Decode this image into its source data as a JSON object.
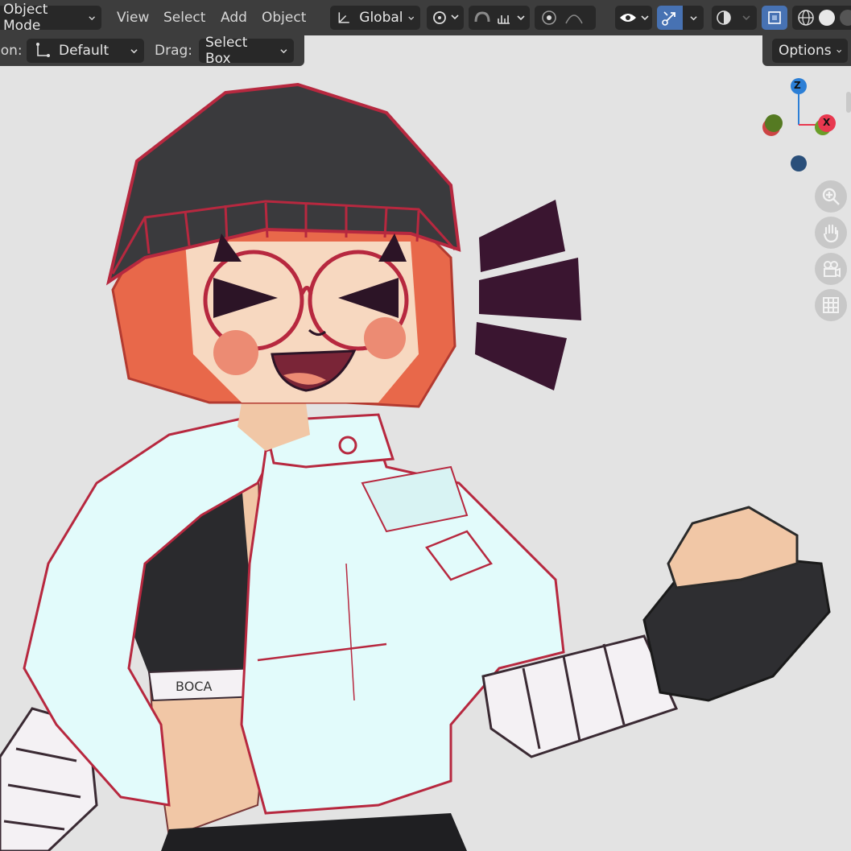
{
  "header": {
    "mode": "Object Mode",
    "menus": [
      "View",
      "Select",
      "Add",
      "Object"
    ],
    "orientation": "Global"
  },
  "toolbar": {
    "orientation_label": "ion:",
    "orientation_value": "Default",
    "drag_label": "Drag:",
    "drag_value": "Select Box",
    "options_label": "Options"
  },
  "gizmo": {
    "z": "Z",
    "x": "X"
  },
  "colors": {
    "header_bg": "#3d3d3d",
    "viewport_bg": "#e3e3e3",
    "x_axis": "#e8384f",
    "y_axis": "#6a9d28",
    "z_axis": "#2c7fd6",
    "active_blue": "#4772b3"
  },
  "icons": [
    "transform-orientation-icon",
    "snap-icon",
    "snap-increment-icon",
    "proportional-edit-icon",
    "falloff-icon",
    "visibility-icon",
    "gizmo-icon",
    "overlay-icon",
    "xray-icon",
    "wireframe-shading-icon",
    "solid-shading-icon",
    "zoom-icon",
    "hand-icon",
    "camera-icon",
    "grid-icon"
  ]
}
